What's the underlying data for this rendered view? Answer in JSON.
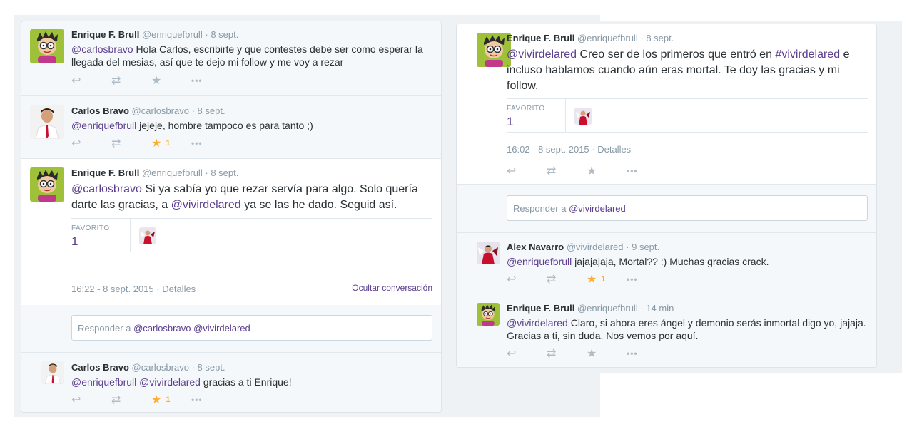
{
  "left": {
    "t1": {
      "name": "Enrique F. Brull",
      "handle": "@enriquefbrull",
      "sep": "·",
      "time": "8 sept.",
      "mention": "@carlosbravo",
      "text": " Hola Carlos, escribirte y que contestes debe ser como esperar la llegada del mesias, así que te dejo mi follow y me voy a rezar"
    },
    "t2": {
      "name": "Carlos Bravo",
      "handle": "@carlosbravo",
      "sep": "·",
      "time": "8 sept.",
      "mention": "@enriquefbrull",
      "text": " jejeje, hombre tampoco es para tanto ;)",
      "fav_count": "1"
    },
    "t3": {
      "name": "Enrique F. Brull",
      "handle": "@enriquefbrull",
      "sep": "·",
      "time": "8 sept.",
      "mention1": "@carlosbravo",
      "text1": " Si ya sabía yo que rezar servía para algo. Solo quería darte las gracias, a ",
      "mention2": "@vivirdelared",
      "text2": " ya se las he dado. Seguid así.",
      "stat_label": "FAVORITO",
      "stat_value": "1",
      "timestamp": "16:22 - 8 sept. 2015",
      "details": "Detalles",
      "hide": "Ocultar conversación"
    },
    "reply": {
      "prefix": "Responder a ",
      "m1": "@carlosbravo",
      "space": " ",
      "m2": "@vivirdelared"
    },
    "t4": {
      "name": "Carlos Bravo",
      "handle": "@carlosbravo",
      "sep": "·",
      "time": "8 sept.",
      "mention1": "@enriquefbrull",
      "space": " ",
      "mention2": "@vivirdelared",
      "text": " gracias a ti Enrique!",
      "fav_count": "1"
    }
  },
  "right": {
    "t1": {
      "name": "Enrique F. Brull",
      "handle": "@enriquefbrull",
      "sep": "·",
      "time": "8 sept.",
      "mention1": "@vivirdelared",
      "text1": " Creo ser de los primeros que entró en ",
      "hashtag": "#vivirdelared",
      "text2": " e incluso hablamos cuando aún eras mortal. Te doy las gracias y mi follow.",
      "stat_label": "FAVORITO",
      "stat_value": "1",
      "timestamp": "16:02 - 8 sept. 2015",
      "details": "Detalles"
    },
    "reply": {
      "prefix": "Responder a ",
      "m1": "@vivirdelared"
    },
    "t2": {
      "name": "Alex Navarro",
      "handle": "@vivirdelared",
      "sep": "·",
      "time": "9 sept.",
      "mention": "@enriquefbrull",
      "text": " jajajajaja, Mortal?? :)  Muchas gracias crack.",
      "fav_count": "1"
    },
    "t3": {
      "name": "Enrique F. Brull",
      "handle": "@enriquefbrull",
      "sep": "·",
      "time": "14 min",
      "mention": "@vivirdelared",
      "text": " Claro, si ahora eres ángel y demonio serás inmortal digo yo, jajaja.  Gracias a ti, sin duda. Nos vemos por aquí."
    }
  },
  "icons": {
    "reply": "reply-icon",
    "retweet": "retweet-icon",
    "favorite": "star-icon",
    "more": "more-icon"
  },
  "colors": {
    "link": "#5b3e8e",
    "favorite_active": "#ffac33",
    "icon_inactive": "#afbcc6",
    "background": "#eef2f5"
  }
}
